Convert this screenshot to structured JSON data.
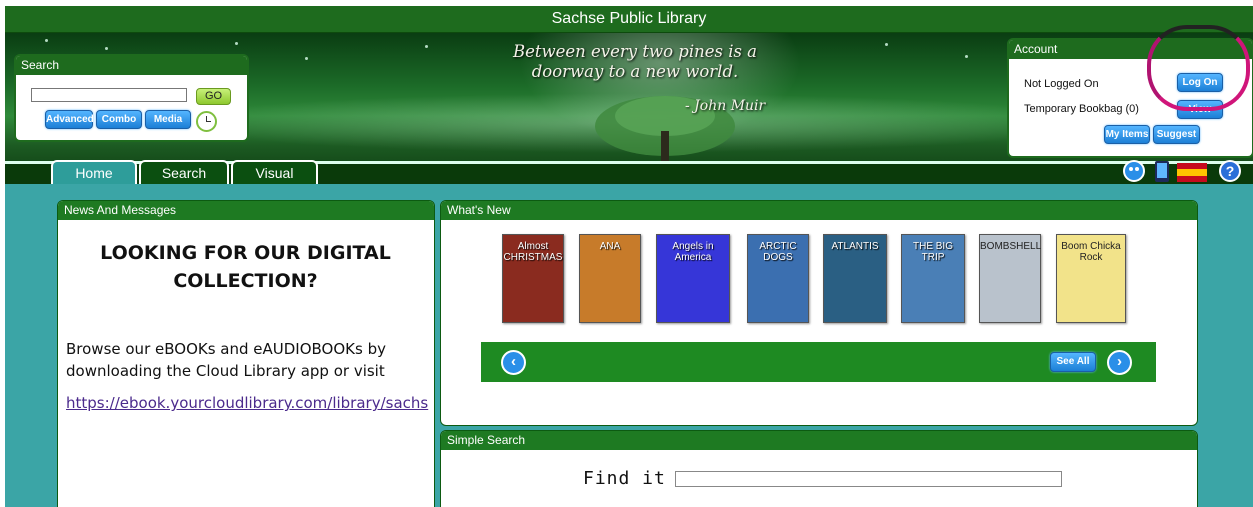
{
  "site": {
    "title": "Sachse Public Library"
  },
  "quote": {
    "text_line1": "Between every two pines is a",
    "text_line2": "doorway to a new world.",
    "author": "- John Muir"
  },
  "search_box": {
    "header": "Search",
    "input_value": "",
    "go_label": "GO",
    "advanced_label": "Advanced",
    "combo_label": "Combo",
    "media_label": "Media",
    "clock_icon": "clock-icon"
  },
  "account": {
    "header": "Account",
    "status": "Not Logged On",
    "logon_label": "Log On",
    "bookbag_label": "Temporary Bookbag (0)",
    "view_label": "View",
    "myitems_label": "My Items",
    "suggest_label": "Suggest"
  },
  "tabs": [
    {
      "label": "Home",
      "active": true
    },
    {
      "label": "Search",
      "active": false
    },
    {
      "label": "Visual",
      "active": false
    }
  ],
  "right_icons": [
    "accessibility-icon",
    "mobile-icon",
    "spanish-flag-icon",
    "help-icon"
  ],
  "news": {
    "header": "News And Messages",
    "title_line1": "LOOKING FOR OUR DIGITAL",
    "title_line2": "COLLECTION?",
    "body_line1": "Browse our eBOOKs and eAUDIOBOOKs by",
    "body_line2": "downloading the Cloud Library app or visit",
    "link": "https://ebook.yourcloudlibrary.com/library/sachs"
  },
  "whats_new": {
    "header": "What's New",
    "covers": [
      {
        "name": "cover-almost-christmas",
        "title": "Almost CHRISTMAS",
        "color": "#8a2b1f"
      },
      {
        "name": "cover-ana",
        "title": "ANA",
        "color": "#c77b2a"
      },
      {
        "name": "cover-angels-in-america",
        "title": "Angels in America",
        "color": "#3636d8"
      },
      {
        "name": "cover-arctic-dogs",
        "title": "ARCTIC DOGS",
        "color": "#3b6fb0"
      },
      {
        "name": "cover-atlantis",
        "title": "ATLANTIS",
        "color": "#2a5f83"
      },
      {
        "name": "cover-big-trip",
        "title": "THE BIG TRIP",
        "color": "#4a7fb6"
      },
      {
        "name": "cover-bombshell",
        "title": "BOMBSHELL",
        "color": "#b9c2cc"
      },
      {
        "name": "cover-boom-chicka-rock",
        "title": "Boom Chicka Rock",
        "color": "#f2e38a"
      }
    ],
    "see_all_label": "See All",
    "prev_icon": "arrow-left-icon",
    "next_icon": "arrow-right-icon"
  },
  "simple_search": {
    "header": "Simple Search",
    "find_label": "Find it",
    "input_value": ""
  }
}
